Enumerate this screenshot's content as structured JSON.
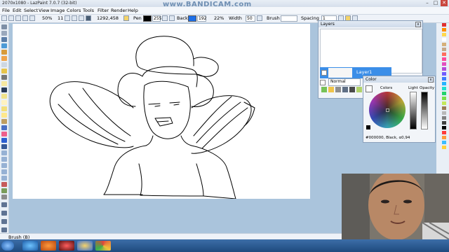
{
  "window": {
    "title": "2070x1080 - LazPaint 7.0.7 (32-bit)",
    "watermark": "www.BANDICAM.com",
    "minimize": "–",
    "maximize": "□",
    "close": "✕"
  },
  "menu": [
    "File",
    "Edit",
    "Select",
    "View",
    "Image",
    "Colors",
    "Tools",
    "Filter",
    "Render",
    "Help"
  ],
  "toolbar": {
    "zoom": "50%",
    "zoom_step": "11",
    "coords": "1292,458",
    "pen_label": "Pen",
    "pen_color": "#000000",
    "pen_alpha": "255",
    "back_label": "Back",
    "back_color": "#1d6fe8",
    "back_alpha": "192",
    "back_percent": "22%",
    "width_label": "Width",
    "width_value": "50",
    "brush_label": "Brush",
    "spacing_label": "Spacing",
    "spacing_value": "1"
  },
  "layers": {
    "title": "Layers",
    "close": "x",
    "layer_name": "Layer1",
    "blend_mode": "Normal"
  },
  "color_panel": {
    "title": "Color",
    "close": "x",
    "colors_label": "Colors",
    "light_label": "Light",
    "opacity_label": "Opacity",
    "value_text": "#000000, Black, α0,94"
  },
  "status": {
    "text": "Brush (B)"
  },
  "taskbar": {
    "apps": [
      "start-button",
      "ie-icon",
      "media-player-icon",
      "bandicam-icon",
      "lazpaint-icon",
      "chrome-icon"
    ]
  }
}
